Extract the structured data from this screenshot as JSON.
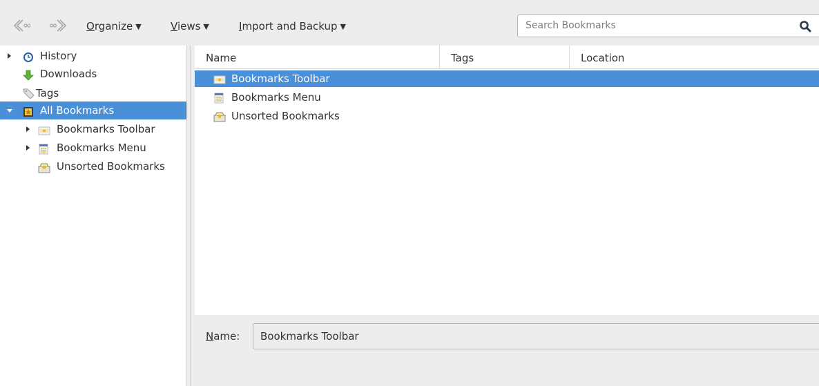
{
  "toolbar": {
    "back_icon": "back-arrow-icon",
    "forward_icon": "forward-arrow-icon",
    "organize": {
      "accel": "O",
      "rest": "rganize"
    },
    "views": {
      "accel": "V",
      "rest": "iews"
    },
    "import_backup": {
      "accel": "I",
      "rest": "mport and Backup"
    },
    "caret": "▼",
    "search_placeholder": "Search Bookmarks",
    "search_icon": "magnifier-icon"
  },
  "sidebar": {
    "items": [
      {
        "label": "History",
        "icon": "clock-icon"
      },
      {
        "label": "Downloads",
        "icon": "download-arrow-icon"
      },
      {
        "label": "Tags",
        "icon": "tag-icon"
      },
      {
        "label": "All Bookmarks",
        "icon": "bookmarks-library-icon"
      },
      {
        "label": "Bookmarks Toolbar",
        "icon": "bookmarks-toolbar-icon"
      },
      {
        "label": "Bookmarks Menu",
        "icon": "bookmarks-menu-icon"
      },
      {
        "label": "Unsorted Bookmarks",
        "icon": "unsorted-bookmarks-icon"
      }
    ]
  },
  "table": {
    "columns": [
      "Name",
      "Tags",
      "Location"
    ],
    "rows": [
      {
        "name": "Bookmarks Toolbar",
        "icon": "bookmarks-toolbar-icon",
        "selected": true
      },
      {
        "name": "Bookmarks Menu",
        "icon": "bookmarks-menu-icon",
        "selected": false
      },
      {
        "name": "Unsorted Bookmarks",
        "icon": "unsorted-bookmarks-icon",
        "selected": false
      }
    ]
  },
  "details": {
    "name_label": {
      "accel": "N",
      "rest": "ame:"
    },
    "name_value": "Bookmarks Toolbar"
  },
  "colors": {
    "selection": "#4a90d9",
    "window_bg": "#ededed",
    "text": "#2e3436"
  }
}
